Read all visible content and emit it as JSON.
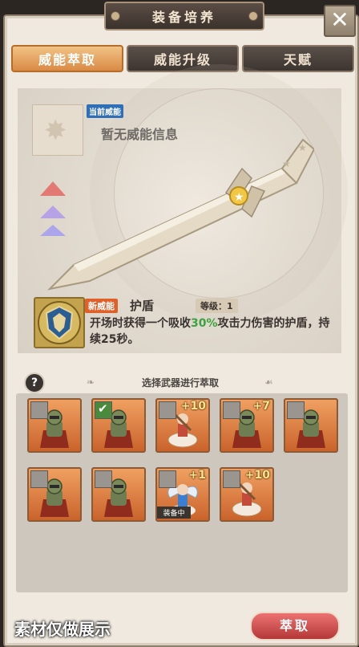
{
  "header": {
    "title": "装备培养",
    "close_label": "✕"
  },
  "tabs": [
    {
      "label": "威能萃取",
      "active": true
    },
    {
      "label": "威能升级",
      "active": false
    },
    {
      "label": "天赋",
      "active": false
    }
  ],
  "current_power": {
    "tag": "当前威能",
    "text": "暂无威能信息"
  },
  "new_power": {
    "tag": "新威能",
    "name": "护盾",
    "level_text": "等级：1",
    "desc_before": "开场时获得一个吸收",
    "desc_highlight": "30%",
    "desc_after": "攻击力伤害的护盾，持续25秒。"
  },
  "selection": {
    "help": "?",
    "label": "选择武器进行萃取",
    "slots": [
      {
        "checked": false,
        "plus": "",
        "equipped": "",
        "type": "knight"
      },
      {
        "checked": true,
        "plus": "",
        "equipped": "",
        "type": "knight"
      },
      {
        "checked": false,
        "plus": "+10",
        "equipped": "",
        "type": "maiden"
      },
      {
        "checked": false,
        "plus": "+7",
        "equipped": "",
        "type": "knight"
      },
      {
        "checked": false,
        "plus": "",
        "equipped": "",
        "type": "knight"
      },
      {
        "checked": false,
        "plus": "",
        "equipped": "",
        "type": "knight"
      },
      {
        "checked": false,
        "plus": "",
        "equipped": "",
        "type": "knight"
      },
      {
        "checked": false,
        "plus": "+1",
        "equipped": "装备中",
        "type": "winged"
      },
      {
        "checked": false,
        "plus": "+10",
        "equipped": "",
        "type": "maiden"
      }
    ]
  },
  "footer": {
    "watermark": "素材仅做展示",
    "extract_label": "萃取"
  },
  "colors": {
    "accent_orange": "#d98a45",
    "button_red": "#b43838",
    "highlight_green": "#3aa33f"
  }
}
